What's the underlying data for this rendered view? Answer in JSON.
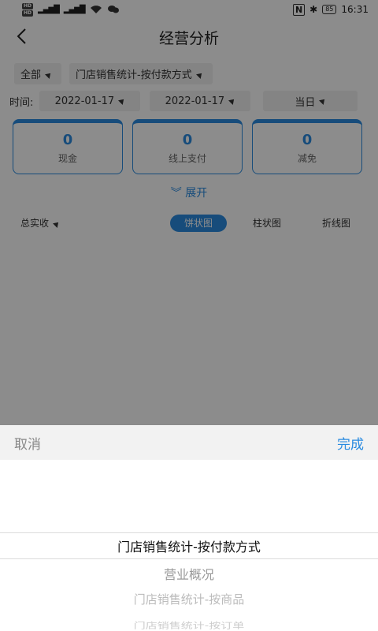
{
  "status_bar": {
    "time": "16:31",
    "battery": "85",
    "hd1": "HD",
    "hd2": "HD"
  },
  "header": {
    "title": "经营分析"
  },
  "filters": {
    "scope": "全部",
    "report": "门店销售统计-按付款方式",
    "time_label": "时间:",
    "start_date": "2022-01-17",
    "end_date": "2022-01-17",
    "period": "当日"
  },
  "cards": [
    {
      "value": "0",
      "label": "现金"
    },
    {
      "value": "0",
      "label": "线上支付"
    },
    {
      "value": "0",
      "label": "减免"
    }
  ],
  "expand_label": "展开",
  "chart_tabs": {
    "metric": "总实收",
    "pie": "饼状图",
    "bar": "柱状图",
    "line": "折线图"
  },
  "picker": {
    "cancel": "取消",
    "done": "完成",
    "options": [
      "门店销售统计-按付款方式",
      "营业概况",
      "门店销售统计-按商品",
      "门店销售统计-按订单"
    ]
  },
  "colors": {
    "accent": "#2a8be0"
  }
}
